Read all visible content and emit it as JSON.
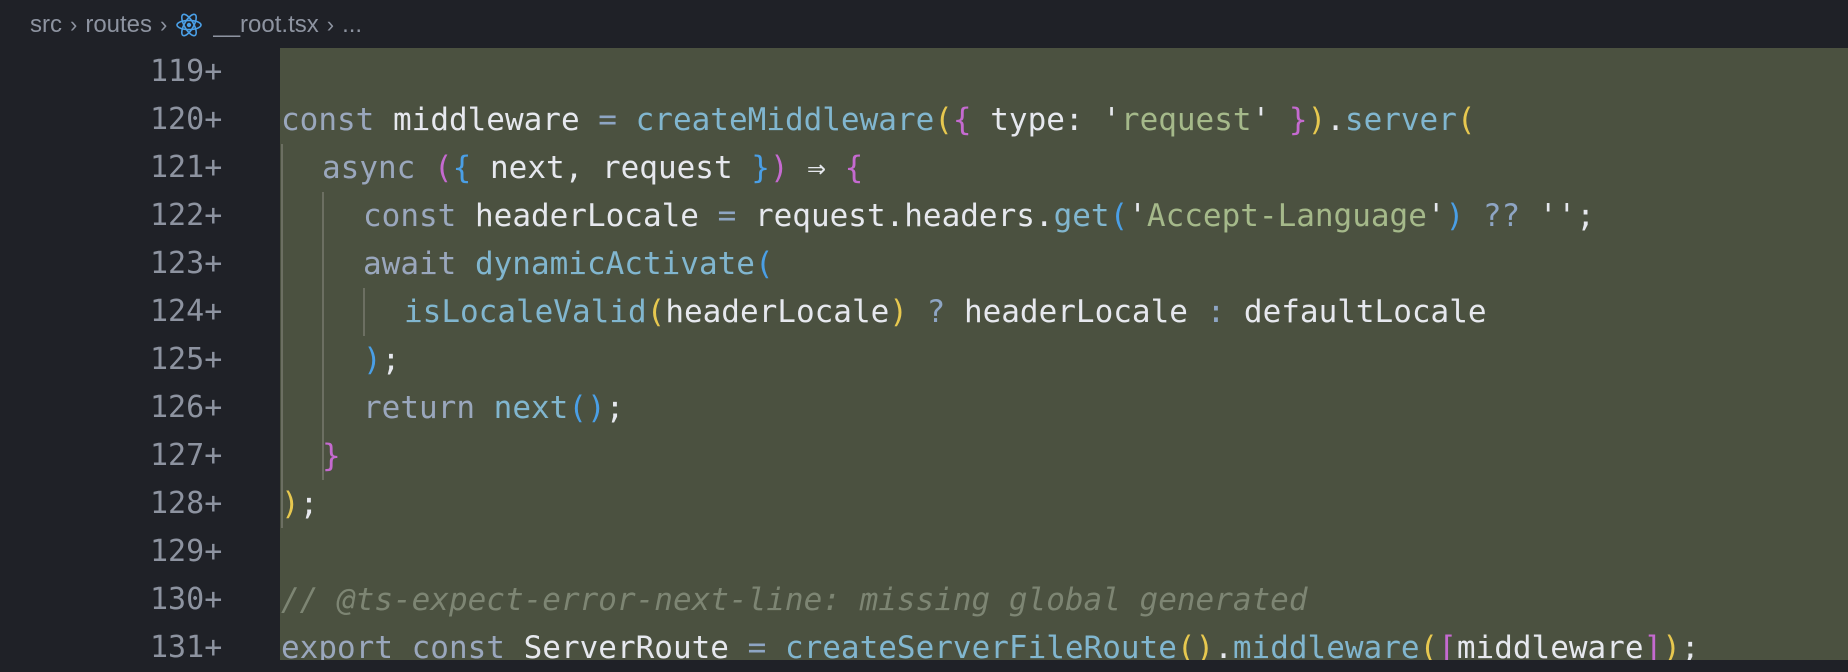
{
  "breadcrumb": {
    "items": [
      "src",
      "routes",
      "__root.tsx",
      "..."
    ],
    "separator": ">"
  },
  "colors": {
    "editor_bg": "#1f2127",
    "diff_added_bg": "#4b5140",
    "keyword": "#9aa7bd",
    "function": "#81b6cf",
    "string": "#a5b98a",
    "comment": "#7d8573"
  },
  "lines": [
    {
      "num": "119",
      "marker": "+"
    },
    {
      "num": "120",
      "marker": "+"
    },
    {
      "num": "121",
      "marker": "+"
    },
    {
      "num": "122",
      "marker": "+"
    },
    {
      "num": "123",
      "marker": "+"
    },
    {
      "num": "124",
      "marker": "+"
    },
    {
      "num": "125",
      "marker": "+"
    },
    {
      "num": "126",
      "marker": "+"
    },
    {
      "num": "127",
      "marker": "+"
    },
    {
      "num": "128",
      "marker": "+"
    },
    {
      "num": "129",
      "marker": "+"
    },
    {
      "num": "130",
      "marker": "+"
    },
    {
      "num": "131",
      "marker": "+"
    }
  ],
  "code": {
    "l120": {
      "kw": "const",
      "name": " middleware ",
      "eq": "=",
      "fn": " createMiddleware",
      "p1": "(",
      "b1": "{",
      "prop": " type: '",
      "str": "request",
      "q": "' ",
      "b1c": "}",
      "p1c": ")",
      "dot": ".",
      "fn2": "server",
      "p2": "("
    },
    "l121": {
      "kw": "async ",
      "p1": "(",
      "b1": "{",
      "args": " next, request ",
      "b1c": "}",
      "p1c": ")",
      "arrow": " ⇒ ",
      "b2": "{"
    },
    "l122": {
      "kw": "const",
      "name": " headerLocale ",
      "eq": "=",
      "obj": " request.headers.",
      "fn": "get",
      "p1": "(",
      "q1": "'",
      "str": "Accept-Language",
      "q2": "'",
      "p1c": ")",
      "op": " ??",
      "tail": " '';"
    },
    "l123": {
      "kw": "await ",
      "fn": "dynamicActivate",
      "p1": "("
    },
    "l124": {
      "fn": "isLocaleValid",
      "p1": "(",
      "arg": "headerLocale",
      "p1c": ")",
      "q": " ?",
      "a": " headerLocale ",
      "c": ":",
      "b": " defaultLocale"
    },
    "l125": {
      "p1c": ")",
      "semi": ";"
    },
    "l126": {
      "kw": "return ",
      "fn": "next",
      "p": "()",
      "semi": ";"
    },
    "l127": {
      "b": "}"
    },
    "l128": {
      "p": ")",
      "semi": ";"
    },
    "l130": {
      "slashes": "// ",
      "text": "@ts-expect-error-next-line: missing global generated"
    },
    "l131": {
      "kw": "export const",
      "name": " ServerRoute ",
      "eq": "=",
      "fn": " createServerFileRoute",
      "p1": "()",
      "dot": ".",
      "fn2": "middleware",
      "p2": "(",
      "br": "[",
      "arg": "middleware",
      "brc": "]",
      "p2c": ")",
      "semi": ";"
    }
  }
}
